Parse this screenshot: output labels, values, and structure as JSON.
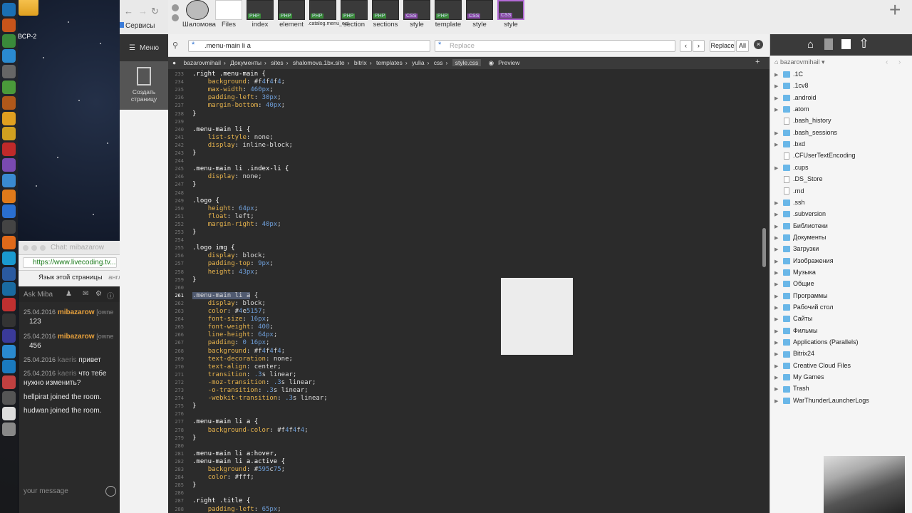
{
  "desktop": {
    "label": "ВСР-2",
    "dock_apps": [
      "Ps",
      "Ai",
      "Dw",
      "Tg",
      "Rk",
      "Lf",
      "S",
      "Ch",
      "Ps2",
      "Op",
      "Vb",
      "Ch2",
      "Ff",
      "Sf",
      "Nt",
      "Ff2",
      "Sk",
      "Qb",
      "Ed",
      "Av",
      "Tm",
      "Mv",
      "Ap",
      "Wb",
      "Pt",
      "Ky",
      "Fs",
      "Dr"
    ]
  },
  "chat": {
    "title": "Chat: mibazarow",
    "url": "https://www.livecoding.tv...",
    "translate_text": "Язык этой страницы",
    "translate_extra": "англи",
    "header": "Ask Miba",
    "messages": [
      {
        "date": "25.04.2016",
        "user": "mibazarow",
        "role": "[owne",
        "text": "123"
      },
      {
        "date": "25.04.2016",
        "user": "mibazarow",
        "role": "[owne",
        "text": "456"
      },
      {
        "date": "25.04.2016",
        "user": "kaeris",
        "text": "привет"
      },
      {
        "date": "25.04.2016",
        "user": "kaeris",
        "text": "что тебе нужно изменить?"
      },
      {
        "text": "hellpirat joined the room."
      },
      {
        "text": "hudwan joined the room."
      }
    ],
    "input_placeholder": "your message"
  },
  "browser": {
    "bookmarks_label": "Сервисы",
    "file_tabs": [
      {
        "label": "Шаломова",
        "badge": ""
      },
      {
        "label": "Files",
        "badge": ""
      },
      {
        "label": "index",
        "badge": "PHP"
      },
      {
        "label": "element",
        "badge": "PHP"
      },
      {
        "label": ".catalog.menu_ext",
        "badge": "PHP"
      },
      {
        "label": "section",
        "badge": "PHP"
      },
      {
        "label": "sections",
        "badge": "PHP"
      },
      {
        "label": "style",
        "badge": "CSS"
      },
      {
        "label": "template",
        "badge": "PHP"
      },
      {
        "label": "style",
        "badge": "CSS"
      },
      {
        "label": "style",
        "badge": "CSS"
      }
    ]
  },
  "app": {
    "menu_label": "Меню",
    "create_label": "Создать страницу"
  },
  "editor": {
    "search_value": ".menu-main li a",
    "replace_placeholder": "Replace",
    "replace_btn": "Replace",
    "all_btn": "All",
    "breadcrumb": [
      "bazarovmihail",
      "Документы",
      "sites",
      "shalomova.1bx.site",
      "bitrix",
      "templates",
      "yulia",
      "css",
      "style.css"
    ],
    "preview_label": "Preview",
    "lines": [
      {
        "n": "233",
        "t": ".right .menu-main {"
      },
      {
        "n": "234",
        "t": "    background: #f4f4f4;"
      },
      {
        "n": "235",
        "t": "    max-width: 460px;"
      },
      {
        "n": "236",
        "t": "    padding-left: 30px;"
      },
      {
        "n": "237",
        "t": "    margin-bottom: 40px;"
      },
      {
        "n": "238",
        "t": "}"
      },
      {
        "n": "239",
        "t": ""
      },
      {
        "n": "240",
        "t": ".menu-main li {"
      },
      {
        "n": "241",
        "t": "    list-style: none;"
      },
      {
        "n": "242",
        "t": "    display: inline-block;"
      },
      {
        "n": "243",
        "t": "}"
      },
      {
        "n": "244",
        "t": ""
      },
      {
        "n": "245",
        "t": ".menu-main li .index-li {"
      },
      {
        "n": "246",
        "t": "    display: none;"
      },
      {
        "n": "247",
        "t": "}"
      },
      {
        "n": "248",
        "t": ""
      },
      {
        "n": "249",
        "t": ".logo {"
      },
      {
        "n": "250",
        "t": "    height: 64px;"
      },
      {
        "n": "251",
        "t": "    float: left;"
      },
      {
        "n": "252",
        "t": "    margin-right: 40px;"
      },
      {
        "n": "253",
        "t": "}"
      },
      {
        "n": "254",
        "t": ""
      },
      {
        "n": "255",
        "t": ".logo img {"
      },
      {
        "n": "256",
        "t": "    display: block;"
      },
      {
        "n": "257",
        "t": "    padding-top: 9px;"
      },
      {
        "n": "258",
        "t": "    height: 43px;"
      },
      {
        "n": "259",
        "t": "}"
      },
      {
        "n": "260",
        "t": ""
      },
      {
        "n": "261",
        "t": ".menu-main li a {"
      },
      {
        "n": "262",
        "t": "    display: block;"
      },
      {
        "n": "263",
        "t": "    color: #4e5157;"
      },
      {
        "n": "264",
        "t": "    font-size: 16px;"
      },
      {
        "n": "265",
        "t": "    font-weight: 400;"
      },
      {
        "n": "266",
        "t": "    line-height: 64px;"
      },
      {
        "n": "267",
        "t": "    padding: 0 16px;"
      },
      {
        "n": "268",
        "t": "    background: #f4f4f4;"
      },
      {
        "n": "269",
        "t": "    text-decoration: none;"
      },
      {
        "n": "270",
        "t": "    text-align: center;"
      },
      {
        "n": "271",
        "t": "    transition: .3s linear;"
      },
      {
        "n": "272",
        "t": "    -moz-transition: .3s linear;"
      },
      {
        "n": "273",
        "t": "    -o-transition: .3s linear;"
      },
      {
        "n": "274",
        "t": "    -webkit-transition: .3s linear;"
      },
      {
        "n": "275",
        "t": "}"
      },
      {
        "n": "276",
        "t": ""
      },
      {
        "n": "277",
        "t": ".menu-main li a {"
      },
      {
        "n": "278",
        "t": "    background-color: #f4f4f4;"
      },
      {
        "n": "279",
        "t": "}"
      },
      {
        "n": "280",
        "t": ""
      },
      {
        "n": "281",
        "t": ".menu-main li a:hover,"
      },
      {
        "n": "282",
        "t": ".menu-main li a.active {"
      },
      {
        "n": "283",
        "t": "    background: #595c75;"
      },
      {
        "n": "284",
        "t": "    color: #fff;"
      },
      {
        "n": "285",
        "t": "}"
      },
      {
        "n": "286",
        "t": ""
      },
      {
        "n": "287",
        "t": ".right .title {"
      },
      {
        "n": "288",
        "t": "    padding-left: 65px;"
      }
    ]
  },
  "tree": {
    "root": "bazarovmihail",
    "items": [
      {
        "name": ".1C",
        "type": "folder"
      },
      {
        "name": ".1cv8",
        "type": "folder"
      },
      {
        "name": ".android",
        "type": "folder"
      },
      {
        "name": ".atom",
        "type": "folder"
      },
      {
        "name": ".bash_history",
        "type": "file"
      },
      {
        "name": ".bash_sessions",
        "type": "folder"
      },
      {
        "name": ".bxd",
        "type": "folder"
      },
      {
        "name": ".CFUserTextEncoding",
        "type": "file"
      },
      {
        "name": ".cups",
        "type": "folder"
      },
      {
        "name": ".DS_Store",
        "type": "file"
      },
      {
        "name": ".rnd",
        "type": "file"
      },
      {
        "name": ".ssh",
        "type": "folder"
      },
      {
        "name": ".subversion",
        "type": "folder"
      },
      {
        "name": "Библиотеки",
        "type": "folder"
      },
      {
        "name": "Документы",
        "type": "folder"
      },
      {
        "name": "Загрузки",
        "type": "folder"
      },
      {
        "name": "Изображения",
        "type": "folder"
      },
      {
        "name": "Музыка",
        "type": "folder"
      },
      {
        "name": "Общие",
        "type": "folder"
      },
      {
        "name": "Программы",
        "type": "folder"
      },
      {
        "name": "Рабочий стол",
        "type": "folder"
      },
      {
        "name": "Сайты",
        "type": "folder"
      },
      {
        "name": "Фильмы",
        "type": "folder"
      },
      {
        "name": "Applications (Parallels)",
        "type": "folder"
      },
      {
        "name": "Bitrix24",
        "type": "folder"
      },
      {
        "name": "Creative Cloud Files",
        "type": "folder"
      },
      {
        "name": "My Games",
        "type": "folder"
      },
      {
        "name": "Trash",
        "type": "folder"
      },
      {
        "name": "WarThunderLauncherLogs",
        "type": "folder"
      }
    ]
  },
  "colors": {
    "dark_bg": "#2b2b2b",
    "accent_tab": "#b36ad6",
    "folder": "#6ab7e8",
    "username": "#e8a13c"
  }
}
